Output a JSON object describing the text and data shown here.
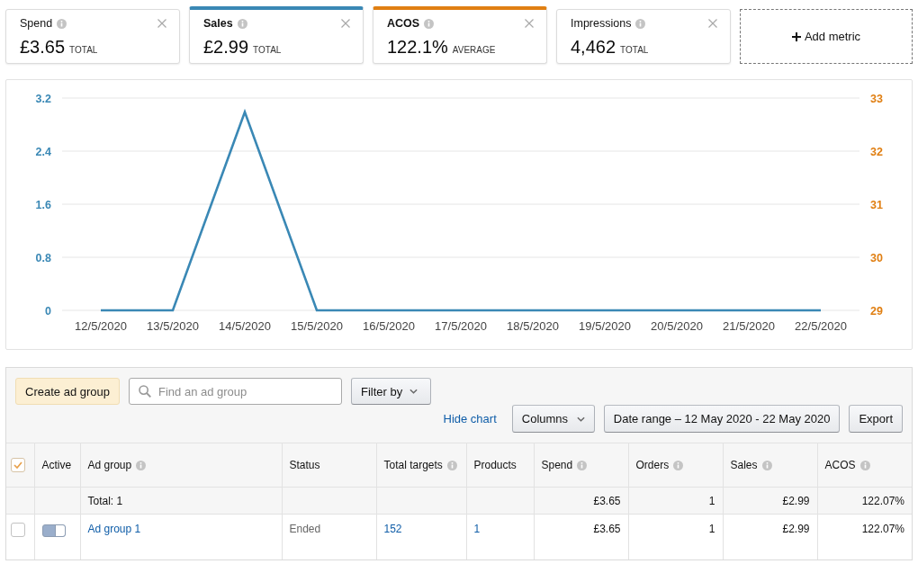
{
  "metrics": [
    {
      "label": "Spend",
      "value": "£3.65",
      "aggregate": "TOTAL",
      "selected": false
    },
    {
      "label": "Sales",
      "value": "£2.99",
      "aggregate": "TOTAL",
      "selected": true,
      "color": "#3a88b5"
    },
    {
      "label": "ACOS",
      "value": "122.1%",
      "aggregate": "AVERAGE",
      "selected": true,
      "color": "#e07f12"
    },
    {
      "label": "Impressions",
      "value": "4,462",
      "aggregate": "TOTAL",
      "selected": false
    }
  ],
  "add_metric": {
    "label": "Add metric"
  },
  "chart": {
    "chart_data": {
      "type": "line",
      "categories": [
        "12/5/2020",
        "13/5/2020",
        "14/5/2020",
        "15/5/2020",
        "16/5/2020",
        "17/5/2020",
        "18/5/2020",
        "19/5/2020",
        "20/5/2020",
        "21/5/2020",
        "22/5/2020"
      ],
      "series": [
        {
          "color": "#3a88b5",
          "values": [
            0,
            0,
            2.99,
            0,
            0,
            0,
            0,
            0,
            0,
            0,
            0
          ]
        }
      ],
      "ylim": [
        0,
        3.2
      ],
      "yticks": [
        0,
        0.8,
        1.6,
        2.4,
        3.2
      ],
      "y2lim": [
        29,
        33
      ],
      "y2ticks": [
        29,
        30,
        31,
        32,
        33
      ],
      "grid": true
    }
  },
  "toolbar": {
    "create_button": "Create ad group",
    "search": {
      "placeholder": "Find an ad group"
    },
    "filter_button": "Filter by",
    "hide_chart_link": "Hide chart",
    "columns_button": "Columns",
    "date_range_button": "Date range – 12 May 2020 - 22 May 2020",
    "export_button": "Export"
  },
  "table": {
    "columns": [
      {
        "kind": "checkbox",
        "checked": true
      },
      {
        "label": "Active",
        "info": false,
        "kind": "toggle"
      },
      {
        "label": "Ad group",
        "info": true,
        "kind": "text"
      },
      {
        "label": "Status",
        "info": false,
        "kind": "text"
      },
      {
        "label": "Total targets",
        "info": true,
        "kind": "text"
      },
      {
        "label": "Products",
        "info": false,
        "kind": "text"
      },
      {
        "label": "Spend",
        "info": true,
        "kind": "number"
      },
      {
        "label": "Orders",
        "info": true,
        "kind": "number"
      },
      {
        "label": "Sales",
        "info": true,
        "kind": "number"
      },
      {
        "label": "ACOS",
        "info": true,
        "kind": "number"
      }
    ],
    "totals": {
      "cells": [
        "",
        "",
        "Total: 1",
        "",
        "",
        "",
        "£3.65",
        "1",
        "£2.99",
        "122.07%"
      ]
    },
    "rows": [
      {
        "cells": [
          {
            "kind": "checkbox",
            "checked": false
          },
          {
            "kind": "toggle",
            "on": true
          },
          {
            "kind": "link",
            "text": "Ad group 1"
          },
          {
            "kind": "status",
            "text": "Ended"
          },
          {
            "kind": "link",
            "text": "152"
          },
          {
            "kind": "link",
            "text": "1"
          },
          {
            "kind": "text",
            "text": "£3.65"
          },
          {
            "kind": "text",
            "text": "1"
          },
          {
            "kind": "text",
            "text": "£2.99"
          },
          {
            "kind": "text",
            "text": "122.07%"
          }
        ]
      }
    ]
  }
}
